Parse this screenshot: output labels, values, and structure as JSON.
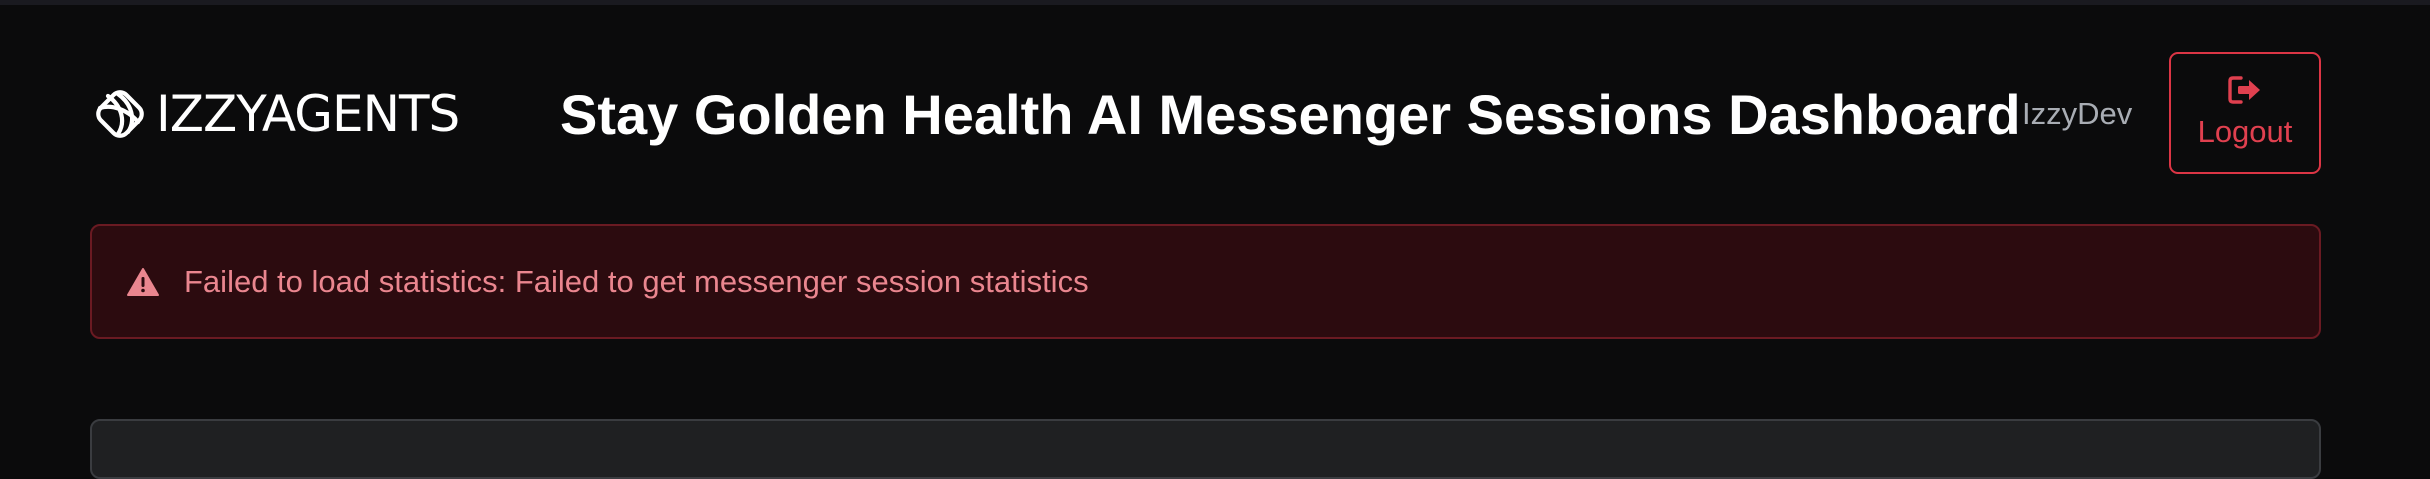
{
  "header": {
    "logo_text": "IZZYAGENTS",
    "title": "Stay Golden Health AI Messenger Sessions Dashboard",
    "username": "IzzyDev",
    "logout_label": "Logout",
    "logout_icon": "sign-out-icon"
  },
  "alert": {
    "icon": "warning-triangle-icon",
    "message": "Failed to load statistics: Failed to get messenger session statistics"
  },
  "colors": {
    "background": "#0b0b0c",
    "danger": "#dc3545",
    "alert_background": "#2c0b0f",
    "alert_text": "#ea868f",
    "muted_text": "#a9adb4"
  }
}
